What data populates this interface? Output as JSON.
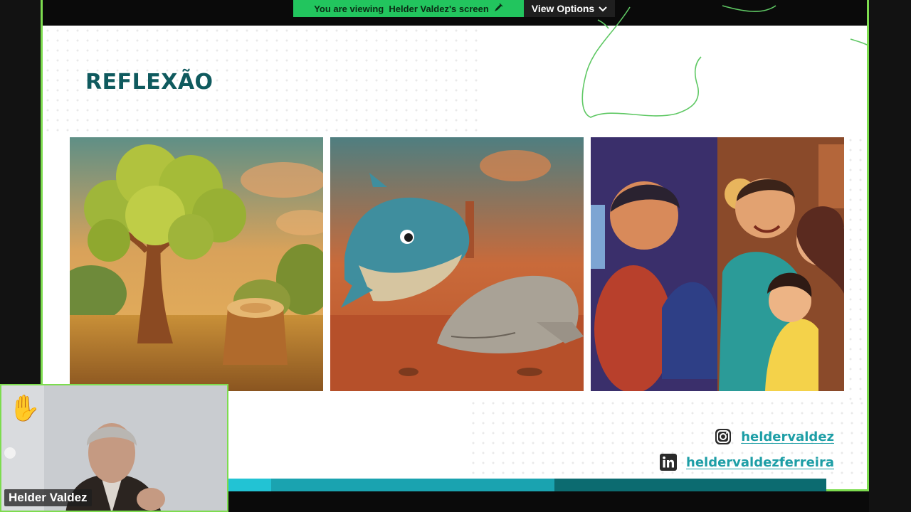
{
  "share_bar": {
    "viewing_text": "You are viewing  Helder Valdez's screen",
    "view_options_label": "View Options"
  },
  "slide": {
    "title": "REFLEXÃO",
    "panels": [
      {
        "name": "tree-and-stump"
      },
      {
        "name": "whales"
      },
      {
        "name": "boy-and-family"
      }
    ],
    "social": {
      "instagram_icon": "instagram-icon",
      "instagram_handle": "heldervaldez",
      "linkedin_icon": "linkedin-icon",
      "linkedin_handle": "heldervaldezferreira"
    },
    "colors": {
      "title": "#0f5a5e",
      "link": "#1d9ea6",
      "stripe": [
        "#22c3d4",
        "#1aa3b0",
        "#0c6b70"
      ]
    }
  },
  "participant": {
    "name": "Helder Valdez",
    "raised_hand_icon": "raised-hand-icon"
  },
  "frame_color": "#7ddc4f"
}
